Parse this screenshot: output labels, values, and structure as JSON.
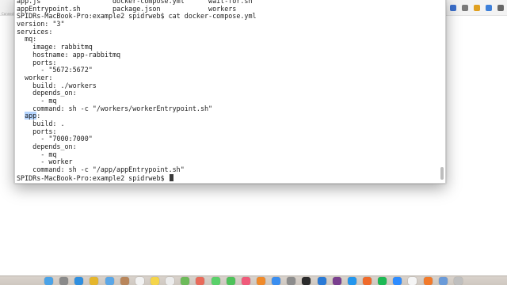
{
  "background": {
    "side_label": "Connect"
  },
  "toolbar_icons": [
    {
      "name": "bookmark-icon",
      "color": "#6e6e6e"
    },
    {
      "name": "extension-icon",
      "color": "#d44a3a"
    },
    {
      "name": "mail-icon",
      "color": "#c43b3b"
    },
    {
      "name": "shield-icon",
      "color": "#3b6fcc"
    },
    {
      "name": "puzzle-icon",
      "color": "#7a7a7a"
    },
    {
      "name": "badge-icon",
      "color": "#e0a020"
    },
    {
      "name": "translate-icon",
      "color": "#3d7fd9"
    },
    {
      "name": "menu-icon",
      "color": "#666666"
    }
  ],
  "terminal": {
    "lines": [
      "app.js                  docker-compose.yml      wait-for.sh",
      "appEntrypoint.sh        package.json            workers",
      "SPIDRs-MacBook-Pro:example2 spidrweb$ cat docker-compose.yml",
      "version: \"3\"",
      "services:",
      "  mq:",
      "    image: rabbitmq",
      "    hostname: app-rabbitmq",
      "    ports:",
      "      - \"5672:5672\"",
      "  worker:",
      "    build: ./workers",
      "    depends_on:",
      "      - mq",
      "    command: sh -c \"/workers/workerEntrypoint.sh\"",
      "  app:",
      "    build: .",
      "    ports:",
      "      - \"7000:7000\"",
      "    depends_on:",
      "      - mq",
      "      - worker",
      "    command: sh -c \"/app/appEntrypoint.sh\""
    ],
    "highlight_before": "  ",
    "highlight_text": "app",
    "prompt": "SPIDRs-MacBook-Pro:example2 spidrweb$ "
  },
  "dock": {
    "icons": [
      {
        "name": "finder-icon",
        "color": "#4aa3e8"
      },
      {
        "name": "launchpad-icon",
        "color": "#8a8a8a"
      },
      {
        "name": "safari-icon",
        "color": "#2f8fe0"
      },
      {
        "name": "chrome-icon",
        "color": "#e5b62c"
      },
      {
        "name": "mail-app-icon",
        "color": "#5aa7e8"
      },
      {
        "name": "contacts-icon",
        "color": "#b9865b"
      },
      {
        "name": "calendar-icon",
        "color": "#f2f2f2"
      },
      {
        "name": "notes-icon",
        "color": "#f5d54a"
      },
      {
        "name": "reminders-icon",
        "color": "#ececec"
      },
      {
        "name": "maps-icon",
        "color": "#6dbb5a"
      },
      {
        "name": "photos-icon",
        "color": "#e96a5a"
      },
      {
        "name": "messages-icon",
        "color": "#5ad16a"
      },
      {
        "name": "facetime-icon",
        "color": "#4ec25a"
      },
      {
        "name": "music-icon",
        "color": "#f05a7a"
      },
      {
        "name": "books-icon",
        "color": "#f08a2a"
      },
      {
        "name": "appstore-icon",
        "color": "#3a8ef0"
      },
      {
        "name": "preferences-icon",
        "color": "#8d8d8d"
      },
      {
        "name": "terminal-app-icon",
        "color": "#2b2b2b"
      },
      {
        "name": "vscode-icon",
        "color": "#2a7ad6"
      },
      {
        "name": "slack-icon",
        "color": "#7a3f8f"
      },
      {
        "name": "docker-icon",
        "color": "#2396ed"
      },
      {
        "name": "postman-icon",
        "color": "#f06a2a"
      },
      {
        "name": "spotify-icon",
        "color": "#1db954"
      },
      {
        "name": "zoom-icon",
        "color": "#2d8cff"
      },
      {
        "name": "notion-icon",
        "color": "#f5f5f5"
      },
      {
        "name": "firefox-icon",
        "color": "#f27a2a"
      },
      {
        "name": "downloads-icon",
        "color": "#6a9ad8"
      },
      {
        "name": "trash-icon",
        "color": "#bfbfbf"
      }
    ]
  }
}
